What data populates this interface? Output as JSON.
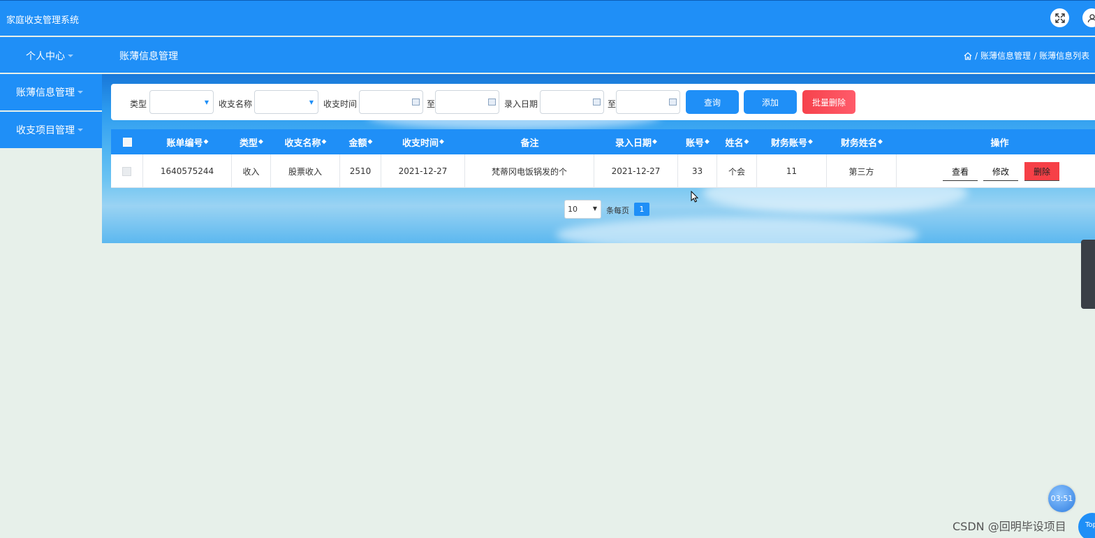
{
  "app": {
    "title": "家庭收支管理系统"
  },
  "header": {
    "fullscreen_icon": "expand-icon",
    "user_icon": "user-icon"
  },
  "nav": {
    "personal_center": "个人中心",
    "page_title": "账薄信息管理",
    "breadcrumb": [
      "账薄信息管理",
      "账薄信息列表"
    ],
    "breadcrumb_sep": "/"
  },
  "sidebar": {
    "items": [
      {
        "label": "账薄信息管理"
      },
      {
        "label": "收支项目管理"
      }
    ]
  },
  "filter": {
    "type_label": "类型",
    "name_label": "收支名称",
    "time_label": "收支时间",
    "to_label": "至",
    "entry_label": "录入日期",
    "search_button": "查询",
    "add_button": "添加",
    "batch_delete_button": "批量删除"
  },
  "table": {
    "columns": [
      "账单编号",
      "类型",
      "收支名称",
      "金额",
      "收支时间",
      "备注",
      "录入日期",
      "账号",
      "姓名",
      "财务账号",
      "财务姓名",
      "操作"
    ],
    "rows": [
      {
        "bill_no": "1640575244",
        "type": "收入",
        "name": "股票收入",
        "amount": "2510",
        "time": "2021-12-27",
        "note": "梵蒂冈电饭锅发的个",
        "entry_date": "2021-12-27",
        "account": "33",
        "username": "个会",
        "fin_account": "11",
        "fin_name": "第三方"
      }
    ],
    "actions": {
      "view": "查看",
      "edit": "修改",
      "delete": "删除"
    }
  },
  "pagination": {
    "page_size": "10",
    "per_page_label": "条每页",
    "current_page": "1"
  },
  "overlays": {
    "timer": "03:51",
    "top_button": "Top",
    "watermark": "CSDN @回明毕设项目"
  },
  "colors": {
    "primary": "#1f8ff7",
    "danger": "#f64047",
    "background": "#e7f0ea"
  }
}
